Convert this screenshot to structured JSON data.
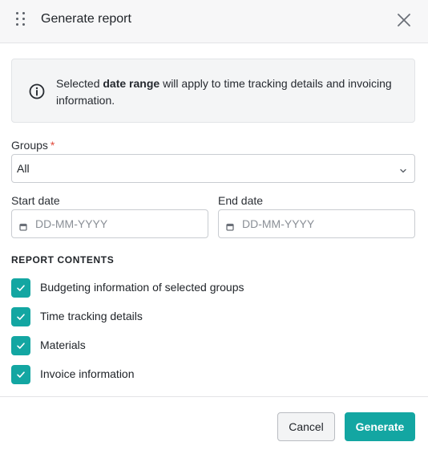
{
  "dialog": {
    "title": "Generate report",
    "icons": {
      "drag": "drag-handle-icon",
      "close": "close-icon"
    }
  },
  "info": {
    "icon": "info-icon",
    "text_before": "Selected ",
    "text_bold": "date range",
    "text_after": " will apply to time tracking details and invoicing information."
  },
  "groups": {
    "label": "Groups",
    "required_mark": "*",
    "value": "All",
    "icon": "chevron-down-icon"
  },
  "start_date": {
    "label": "Start date",
    "placeholder": "DD-MM-YYYY",
    "value": "",
    "icon": "calendar-icon"
  },
  "end_date": {
    "label": "End date",
    "placeholder": "DD-MM-YYYY",
    "value": "",
    "icon": "calendar-icon"
  },
  "report_contents": {
    "heading": "REPORT CONTENTS",
    "items": [
      {
        "label": "Budgeting information of selected groups",
        "checked": true
      },
      {
        "label": "Time tracking details",
        "checked": true
      },
      {
        "label": "Materials",
        "checked": true
      },
      {
        "label": "Invoice information",
        "checked": true
      }
    ]
  },
  "buttons": {
    "cancel": "Cancel",
    "generate": "Generate"
  },
  "colors": {
    "accent": "#13a6a2",
    "required": "#e0493a",
    "header_bg": "#f7f7f8",
    "info_bg": "#f4f5f6"
  }
}
